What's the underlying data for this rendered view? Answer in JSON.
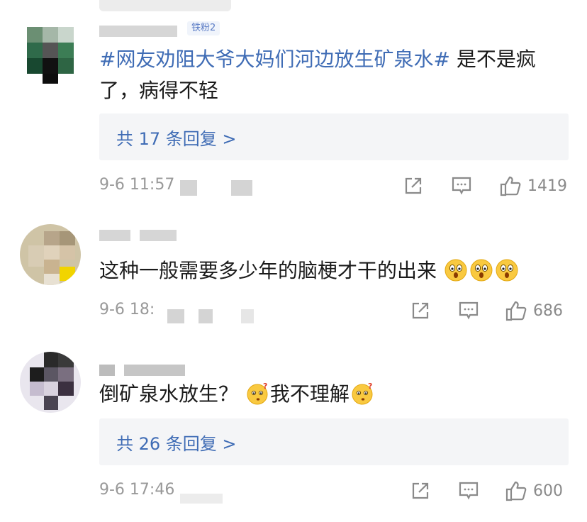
{
  "comments": [
    {
      "text_hashtag": "#网友劝阻大爷大妈们河边放生矿泉水#",
      "text_rest": " 是不是疯了，病得不轻",
      "emojis": [],
      "replies_label": "共 17 条回复 >",
      "timestamp": "9-6 11:57",
      "likes": "1419",
      "fan_badge": "铁粉2"
    },
    {
      "text_hashtag": "",
      "text_rest": "这种一般需要多少年的脑梗才干的出来",
      "emojis": [
        "shocked-emoji",
        "shocked-emoji",
        "shocked-emoji"
      ],
      "replies_label": "",
      "timestamp": "9-6 18:",
      "likes": "686"
    },
    {
      "text_hashtag": "",
      "text_rest_a": "倒矿泉水放生？",
      "text_rest_b": "我不理解",
      "emojis": [
        "confused-emoji",
        "confused-emoji"
      ],
      "replies_label": "共 26 条回复 >",
      "timestamp": "9-6 17:46",
      "likes": "600"
    }
  ],
  "colors": {
    "link": "#3f6cb5",
    "meta": "#999999",
    "reply_bg": "#f4f5f7",
    "emoji_face": "#f9c940"
  },
  "icons": [
    "share-icon",
    "comment-icon",
    "like-icon"
  ]
}
